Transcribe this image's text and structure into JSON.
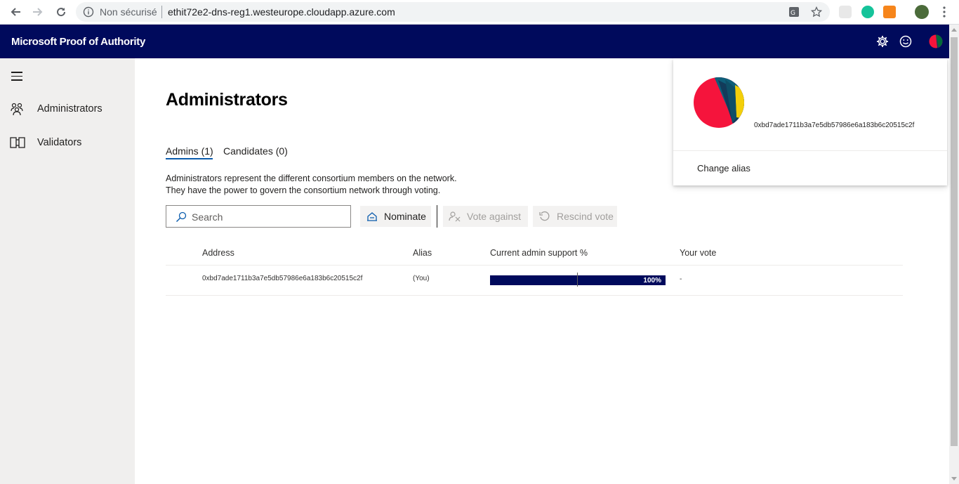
{
  "browser": {
    "security_label": "Non sécurisé",
    "url": "ethit72e2-dns-reg1.westeurope.cloudapp.azure.com"
  },
  "app": {
    "title": "Microsoft Proof of Authority"
  },
  "sidebar": {
    "items": [
      {
        "label": "Administrators",
        "icon": "people-icon"
      },
      {
        "label": "Validators",
        "icon": "book-icon"
      }
    ]
  },
  "main": {
    "title": "Administrators",
    "tabs": [
      {
        "label": "Admins (1)",
        "active": true
      },
      {
        "label": "Candidates (0)",
        "active": false
      }
    ],
    "description_line1": "Administrators represent the different consortium members on the network.",
    "description_line2": "They have the power to govern the consortium network through voting.",
    "search": {
      "placeholder": "Search",
      "value": ""
    },
    "commands": {
      "nominate": "Nominate",
      "vote_against": "Vote against",
      "rescind_vote": "Rescind vote"
    },
    "table": {
      "columns": [
        "Address",
        "Alias",
        "Current admin support %",
        "Your vote"
      ],
      "rows": [
        {
          "address": "0xbd7ade1711b3a7e5db57986e6a183b6c20515c2f",
          "alias": "(You)",
          "support": 100,
          "support_label": "100%",
          "vote": "-"
        }
      ]
    }
  },
  "account_panel": {
    "address": "0xbd7ade1711b3a7e5db57986e6a183b6c20515c2f",
    "change_alias": "Change alias"
  },
  "colors": {
    "header_bg": "#000a5c",
    "accent": "#0b5cad",
    "progress_fill": "#000a5c",
    "sidebar_bg": "#f0efee"
  }
}
